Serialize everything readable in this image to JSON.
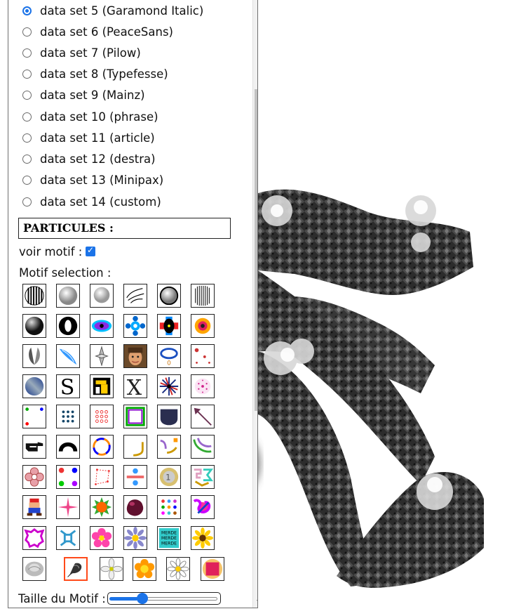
{
  "datasets": [
    {
      "label": "data set 5 (Garamond Italic)",
      "checked": true
    },
    {
      "label": "data set 6 (PeaceSans)",
      "checked": false
    },
    {
      "label": "data set 7 (Pilow)",
      "checked": false
    },
    {
      "label": "data set 8 (Typefesse)",
      "checked": false
    },
    {
      "label": "data set 9 (Mainz)",
      "checked": false
    },
    {
      "label": "data set 10 (phrase)",
      "checked": false
    },
    {
      "label": "data set 11 (article)",
      "checked": false
    },
    {
      "label": "data set 12 (destra)",
      "checked": false
    },
    {
      "label": "data set 13 (Minipax)",
      "checked": false
    },
    {
      "label": "data set 14 (custom)",
      "checked": false
    }
  ],
  "section_title": "PARTICULES :",
  "voir_motif": {
    "label": "voir motif :",
    "checked": true
  },
  "motif_selection": {
    "label": "Motif selection :",
    "selected_index": 55,
    "merde_text": [
      "MERDE",
      "MERDE",
      "MERDE"
    ]
  },
  "taille_motif": {
    "label": "Taille du Motif :",
    "value": 0.28
  },
  "colors": {
    "accent": "#1b73e8",
    "selection": "#ff4a1a"
  }
}
